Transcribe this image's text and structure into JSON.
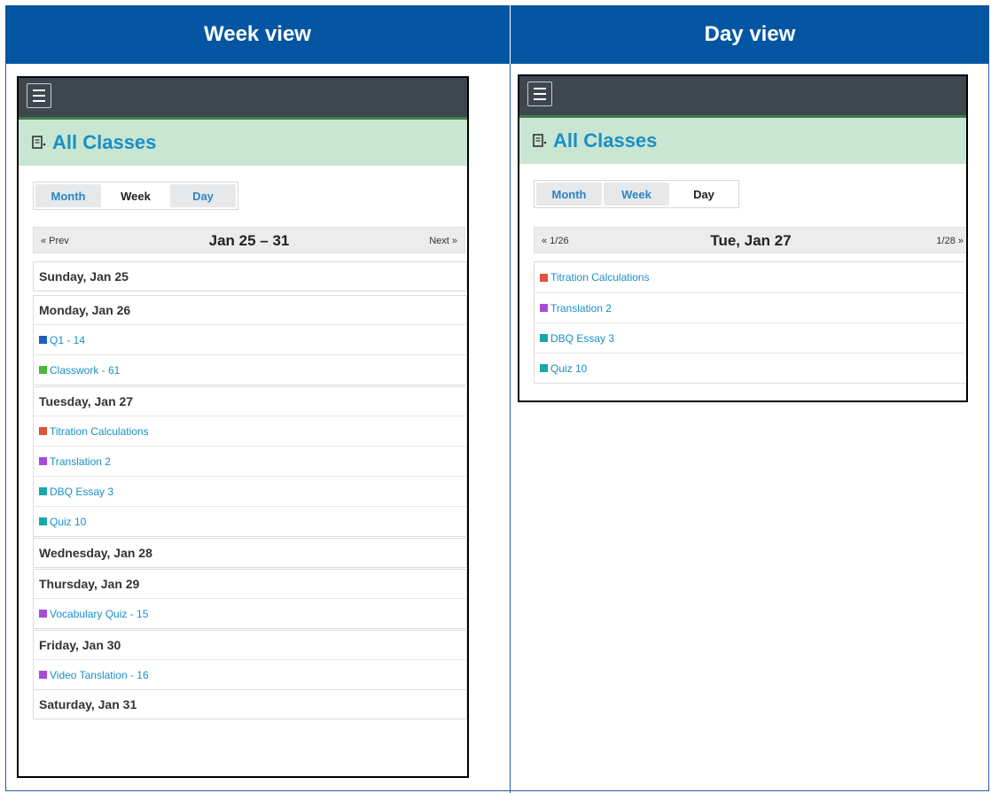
{
  "columns": {
    "week_heading": "Week view",
    "day_heading": "Day view"
  },
  "section_title": "All Classes",
  "view_tabs": [
    "Month",
    "Week",
    "Day"
  ],
  "week": {
    "active_tab": "Week",
    "prev": "« Prev",
    "next": "Next »",
    "range": "Jan 25 – 31",
    "days": [
      {
        "label": "Sunday, Jan 25",
        "events": []
      },
      {
        "label": "Monday, Jan 26",
        "events": [
          {
            "text": "Q1 - 14",
            "color": "#1f5fbf"
          },
          {
            "text": "Classwork - 61",
            "color": "#4cb838"
          }
        ]
      },
      {
        "label": "Tuesday, Jan 27",
        "events": [
          {
            "text": "Titration Calculations",
            "color": "#e0533c"
          },
          {
            "text": "Translation 2",
            "color": "#a84bd8"
          },
          {
            "text": "DBQ Essay 3",
            "color": "#19a6a6"
          },
          {
            "text": "Quiz 10",
            "color": "#19a6a6"
          }
        ]
      },
      {
        "label": "Wednesday, Jan 28",
        "events": []
      },
      {
        "label": "Thursday, Jan 29",
        "events": [
          {
            "text": "Vocabulary Quiz - 15",
            "color": "#a84bd8"
          }
        ]
      },
      {
        "label": "Friday, Jan 30",
        "events": [
          {
            "text": "Video Tanslation - 16",
            "color": "#a84bd8"
          }
        ]
      },
      {
        "label": "Saturday, Jan 31",
        "events": []
      }
    ]
  },
  "day": {
    "active_tab": "Day",
    "prev": "« 1/26",
    "next": "1/28 »",
    "date": "Tue, Jan 27",
    "events": [
      {
        "text": "Titration Calculations",
        "color": "#e0533c"
      },
      {
        "text": "Translation 2",
        "color": "#a84bd8"
      },
      {
        "text": "DBQ Essay 3",
        "color": "#19a6a6"
      },
      {
        "text": "Quiz 10",
        "color": "#19a6a6"
      }
    ]
  },
  "colors": {
    "header_blue": "#0456a3",
    "topbar": "#3e4650",
    "classes_bg": "#c8e6d2",
    "link": "#1a8fc6"
  }
}
